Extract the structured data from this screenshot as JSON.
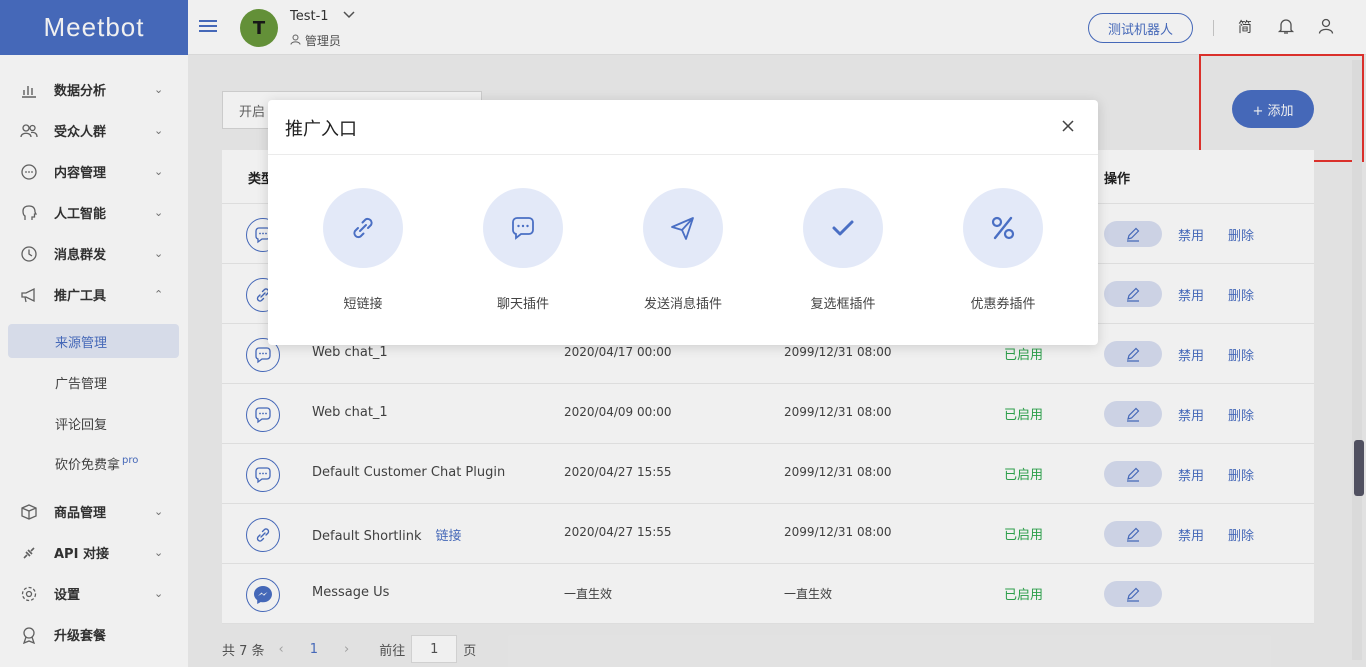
{
  "header": {
    "logo": "Meetbot",
    "account_initial": "T",
    "account_name": "Test-1",
    "account_role": "管理员",
    "test_bot_label": "测试机器人",
    "lang_label": "简"
  },
  "sidebar": {
    "items": [
      {
        "label": "数据分析"
      },
      {
        "label": "受众人群"
      },
      {
        "label": "内容管理"
      },
      {
        "label": "人工智能"
      },
      {
        "label": "消息群发"
      },
      {
        "label": "推广工具"
      }
    ],
    "sub_items": [
      {
        "label": "来源管理"
      },
      {
        "label": "广告管理"
      },
      {
        "label": "评论回复"
      },
      {
        "label": "砍价免费拿",
        "badge": "pro"
      }
    ],
    "items_bottom": [
      {
        "label": "商品管理"
      },
      {
        "label": "API 对接"
      },
      {
        "label": "设置"
      },
      {
        "label": "升级套餐"
      }
    ]
  },
  "main": {
    "filter_label": "开启",
    "add_button": "+ 添加",
    "table": {
      "col_type": "类型",
      "col_actions": "操作",
      "action_disable": "禁用",
      "action_delete": "删除",
      "rows": [
        {
          "type": "chat",
          "name": "",
          "start": "",
          "end": "",
          "status": "",
          "has_actions": true
        },
        {
          "type": "link",
          "name": "",
          "start": "",
          "end": "",
          "status": "",
          "has_actions": true
        },
        {
          "type": "chat",
          "name": "Web chat_1",
          "start": "2020/04/17 00:00",
          "end": "2099/12/31 08:00",
          "status": "已启用",
          "has_actions": true
        },
        {
          "type": "chat",
          "name": "Web chat_1",
          "start": "2020/04/09 00:00",
          "end": "2099/12/31 08:00",
          "status": "已启用",
          "has_actions": true
        },
        {
          "type": "chat",
          "name": "Default Customer Chat Plugin",
          "start": "2020/04/27 15:55",
          "end": "2099/12/31 08:00",
          "status": "已启用",
          "has_actions": true
        },
        {
          "type": "link",
          "name": "Default Shortlink",
          "tag": "链接",
          "start": "2020/04/27 15:55",
          "end": "2099/12/31 08:00",
          "status": "已启用",
          "has_actions": true
        },
        {
          "type": "messenger",
          "name": "Message Us",
          "start": "一直生效",
          "end": "一直生效",
          "status": "已启用",
          "has_actions": false
        }
      ]
    },
    "pager": {
      "total": "共 7 条",
      "current_page": "1",
      "goto_label": "前往",
      "goto_value": "1",
      "page_suffix": "页"
    }
  },
  "modal": {
    "title": "推广入口",
    "options": [
      {
        "label": "短链接",
        "icon": "link-icon"
      },
      {
        "label": "聊天插件",
        "icon": "chat-bubble-icon"
      },
      {
        "label": "发送消息插件",
        "icon": "send-icon"
      },
      {
        "label": "复选框插件",
        "icon": "checkmark-icon"
      },
      {
        "label": "优惠券插件",
        "icon": "percent-icon"
      }
    ]
  },
  "colors": {
    "brand": "#4a6fc4",
    "status_enabled": "#2fa84f",
    "highlight": "#e8342e"
  }
}
